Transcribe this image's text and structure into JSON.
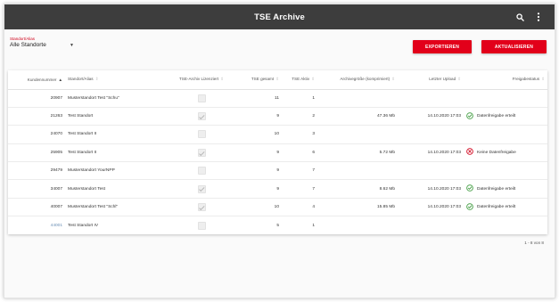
{
  "appbar": {
    "title": "TSE Archive",
    "icons": [
      "search-icon",
      "more-vert-icon"
    ]
  },
  "filter": {
    "label": "Standort/Alias",
    "value": "Alle Standorte"
  },
  "buttons": {
    "export": "Exportieren",
    "refresh": "Aktualisieren"
  },
  "colors": {
    "appbar": "#3d3d3d",
    "accent": "#e2001a",
    "status_ok": "#3c9a3c",
    "status_error": "#d0021b"
  },
  "table": {
    "headers": {
      "kundennummer": "Kundennummer",
      "standort": "Standort/Alias",
      "lizenziert": "TSE-Archiv Lizenziert",
      "gesamt": "TSE gesamt",
      "aktiv": "TSE Aktiv",
      "groesse": "Archivegröße (komprimiert)",
      "upload": "Letzter Upload",
      "freigabe": "Freigabestatus"
    },
    "sort": {
      "column": "kundennummer",
      "direction": "asc"
    },
    "rows": [
      {
        "kundennummer": "20907",
        "standort": "Musterstandort Test \"Schu\"",
        "lizenziert": false,
        "gesamt": "11",
        "aktiv": "1",
        "groesse": "",
        "upload": "",
        "status": "",
        "status_type": ""
      },
      {
        "kundennummer": "21263",
        "standort": "Test Standort",
        "lizenziert": true,
        "gesamt": "9",
        "aktiv": "2",
        "groesse": "47.36 Mb",
        "upload": "14.10.2020 17:03",
        "status": "Datenfreigabe erteilt",
        "status_type": "ok"
      },
      {
        "kundennummer": "24070",
        "standort": "Test Standort II",
        "lizenziert": false,
        "gesamt": "10",
        "aktiv": "3",
        "groesse": "",
        "upload": "",
        "status": "",
        "status_type": ""
      },
      {
        "kundennummer": "25905",
        "standort": "Test Standort II",
        "lizenziert": true,
        "gesamt": "9",
        "aktiv": "6",
        "groesse": "5.72 Mb",
        "upload": "14.10.2020 17:03",
        "status": "Keine Datenfreigabe",
        "status_type": "error"
      },
      {
        "kundennummer": "29479",
        "standort": "Musterstandort YourNPP",
        "lizenziert": false,
        "gesamt": "9",
        "aktiv": "7",
        "groesse": "",
        "upload": "",
        "status": "",
        "status_type": ""
      },
      {
        "kundennummer": "34007",
        "standort": "Musterstandort Test",
        "lizenziert": true,
        "gesamt": "9",
        "aktiv": "7",
        "groesse": "8.62 Mb",
        "upload": "14.10.2020 17:03",
        "status": "Datenfreigabe erteilt",
        "status_type": "ok"
      },
      {
        "kundennummer": "40007",
        "standort": "Musterstandort Test \"Schl\"",
        "lizenziert": true,
        "gesamt": "10",
        "aktiv": "4",
        "groesse": "15.85 Mb",
        "upload": "14.10.2020 17:03",
        "status": "Datenfreigabe erteilt",
        "status_type": "ok"
      },
      {
        "kundennummer": "44001",
        "standort": "Test Standort IV",
        "lizenziert": false,
        "gesamt": "5",
        "aktiv": "1",
        "groesse": "",
        "upload": "",
        "status": "",
        "status_type": "",
        "kundennummer_link": true
      }
    ]
  },
  "pager": "1 - 8 von 8"
}
